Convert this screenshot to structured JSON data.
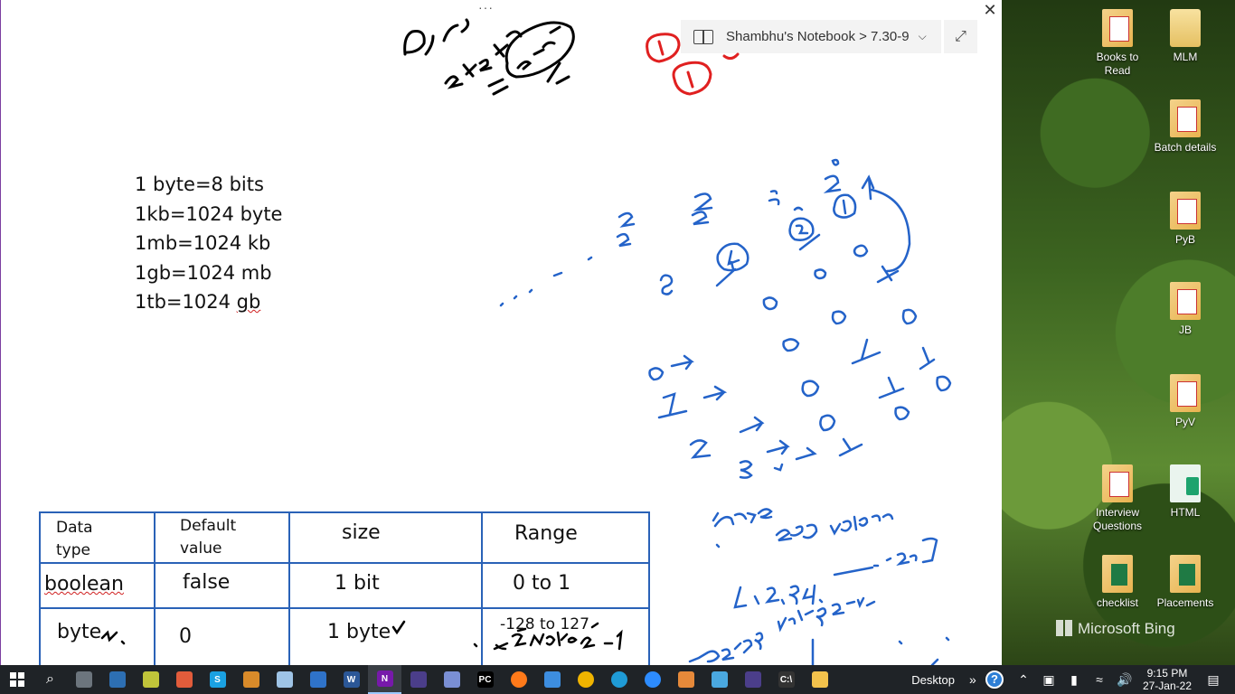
{
  "window": {
    "dots": "···",
    "close": "✕",
    "breadcrumb": "Shambhu's Notebook > 7.30-9",
    "expand": "⤢"
  },
  "notes": {
    "lines": [
      "1 byte=8 bits",
      "1kb=1024 byte",
      "1mb=1024 kb",
      "1gb=1024 mb"
    ],
    "last_line_prefix": "1tb=1024 ",
    "last_line_word": "gb"
  },
  "table": {
    "headers": [
      "Data\ntype",
      "Default\nvalue",
      "size",
      "Range"
    ],
    "rows": [
      {
        "type": "boolean",
        "default": "false",
        "size": "1 bit",
        "range": "0 to 1"
      },
      {
        "type": "byte",
        "default": "0",
        "size": "1 byte",
        "range": "-128 to 127"
      }
    ]
  },
  "desktop": {
    "icons": [
      {
        "label": "Books to Read",
        "kind": "pdf"
      },
      {
        "label": "MLM",
        "kind": "folder"
      },
      {
        "label": "Batch details",
        "kind": "pdf"
      },
      {
        "label": "PyB",
        "kind": "pdf"
      },
      {
        "label": "JB",
        "kind": "pdf"
      },
      {
        "label": "PyV",
        "kind": "pdf"
      },
      {
        "label": "Interview Questions",
        "kind": "pdf"
      },
      {
        "label": "HTML",
        "kind": "html"
      },
      {
        "label": "checklist",
        "kind": "xls"
      },
      {
        "label": "Placements",
        "kind": "xls"
      }
    ],
    "bing": "Microsoft Bing"
  },
  "taskbar": {
    "apps": [
      "search",
      "calculator",
      "keyboard",
      "notepad-plus",
      "paint",
      "skype",
      "office",
      "sticky-notes",
      "store",
      "word",
      "onenote",
      "eclipse",
      "photos",
      "pycharm",
      "firefox",
      "remote-desktop",
      "chrome",
      "edge",
      "zoom",
      "settings",
      "snowflake",
      "eclipse-2",
      "cmd",
      "file-explorer"
    ],
    "desktop_label": "Desktop",
    "chevron": "»",
    "time": "9:15 PM",
    "date": "27-Jan-22"
  }
}
